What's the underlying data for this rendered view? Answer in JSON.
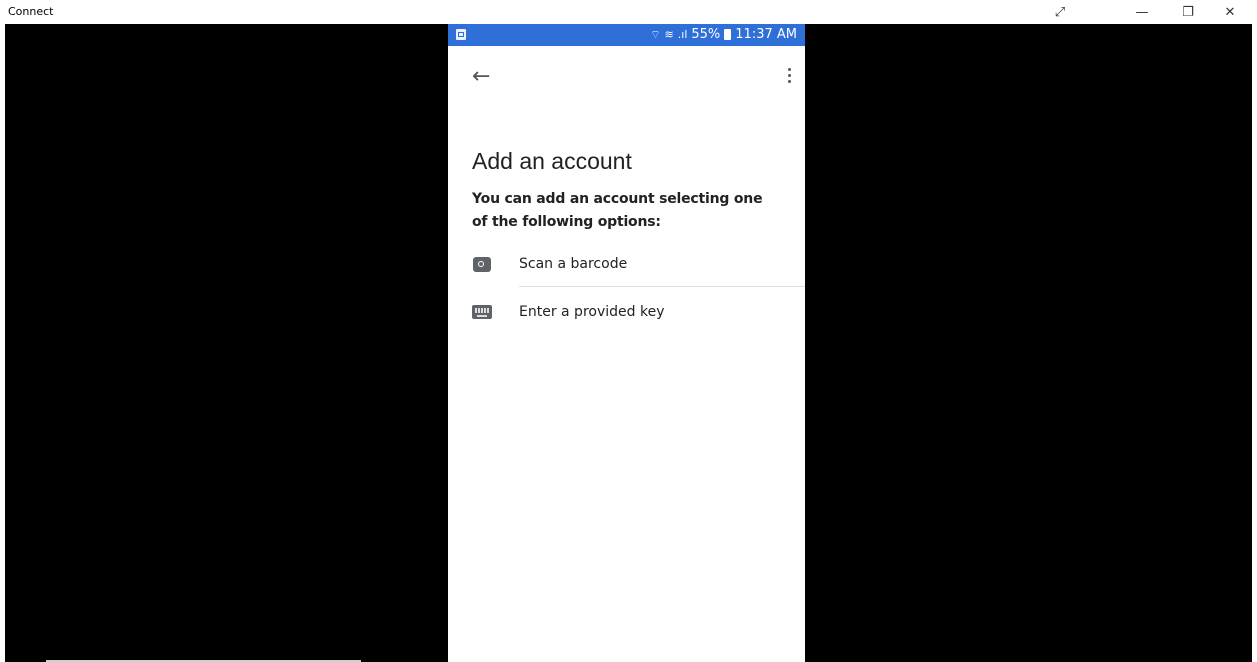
{
  "window": {
    "title": "Connect",
    "controls": {
      "fullscreen": "⤢",
      "minimize": "—",
      "restore": "❐",
      "close": "✕"
    }
  },
  "phone": {
    "status_bar": {
      "battery_percent": "55%",
      "time": "11:37 AM",
      "color": "#2f6fd8"
    },
    "toolbar": {
      "back_icon": "arrow-left-icon",
      "menu_icon": "more-vertical-icon"
    },
    "heading": "Add an account",
    "description": "You can add an account selecting one of the following options:",
    "options": [
      {
        "label": "Scan a barcode",
        "icon": "camera-icon"
      },
      {
        "label": "Enter a provided key",
        "icon": "keyboard-icon"
      }
    ]
  }
}
